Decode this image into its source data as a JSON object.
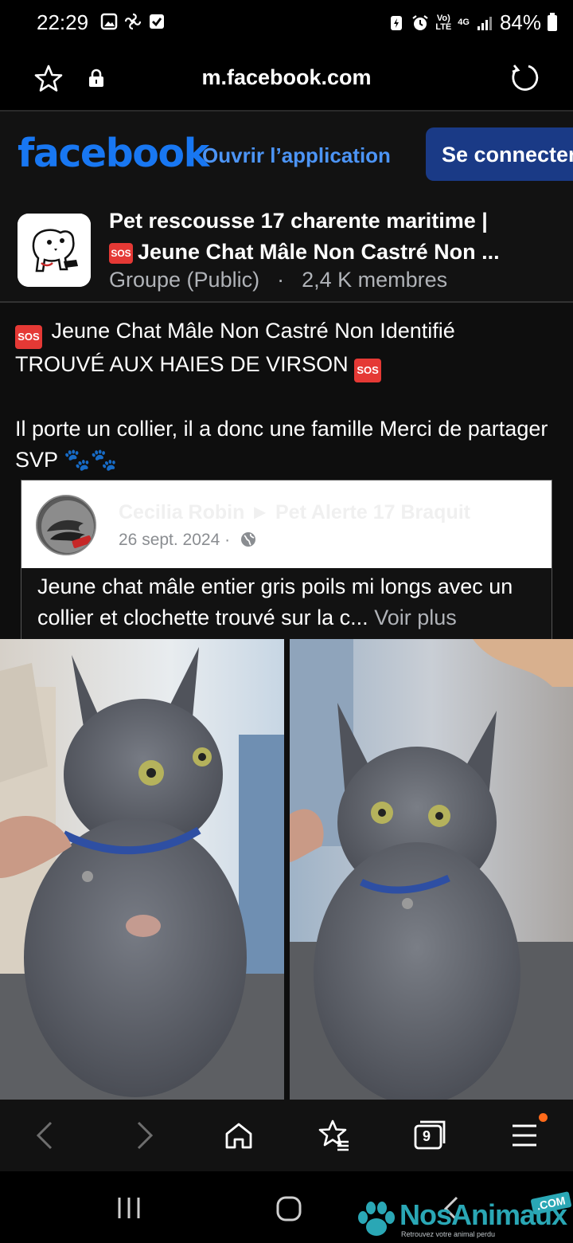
{
  "status_bar": {
    "time": "22:29",
    "network_label": "Vo)\nLTE",
    "signal_label": "4G",
    "battery": "84%"
  },
  "browser": {
    "url": "m.facebook.com",
    "icons": [
      "star-icon",
      "lock-icon",
      "reload-icon"
    ]
  },
  "facebook_header": {
    "logo": "facebook",
    "open_app_label": "Ouvrir l’application",
    "connect_label": "Se connecter",
    "brand_color": "#1877f2"
  },
  "group": {
    "title_line1": "Pet rescousse 17 charente maritime |",
    "title_line2": "Jeune Chat Mâle Non Castré Non ...",
    "sos_label": "SOS",
    "privacy": "Groupe (Public)",
    "members": "2,4 K membres"
  },
  "post": {
    "line1_text": "Jeune Chat Mâle Non Castré Non Identifié",
    "line2_text": "TROUVÉ AUX HAIES DE VIRSON",
    "sos_label": "SOS",
    "body": "Il porte un collier, il a donc une famille Merci de partager SVP",
    "paws": "🐾🐾"
  },
  "shared_post": {
    "author": "Cecilia Robin ► Pet Alerte 17 Braquit",
    "date": "26 sept. 2024",
    "separator": "·",
    "text": "Jeune chat mâle entier gris poils mi longs avec un collier et clochette trouvé sur la c...",
    "see_more": "Voir plus"
  },
  "photos": {
    "items": [
      "grey-cat-photo-left",
      "grey-cat-photo-right"
    ]
  },
  "browser_nav": {
    "tabs_count": "9",
    "icons": [
      "back-icon",
      "forward-icon",
      "home-icon",
      "bookmarks-icon",
      "tabs-icon",
      "menu-icon"
    ]
  },
  "watermark": {
    "brand": "NosAnimaux",
    "tagline": "Retrouvez votre animal perdu",
    "tld": ".COM"
  }
}
